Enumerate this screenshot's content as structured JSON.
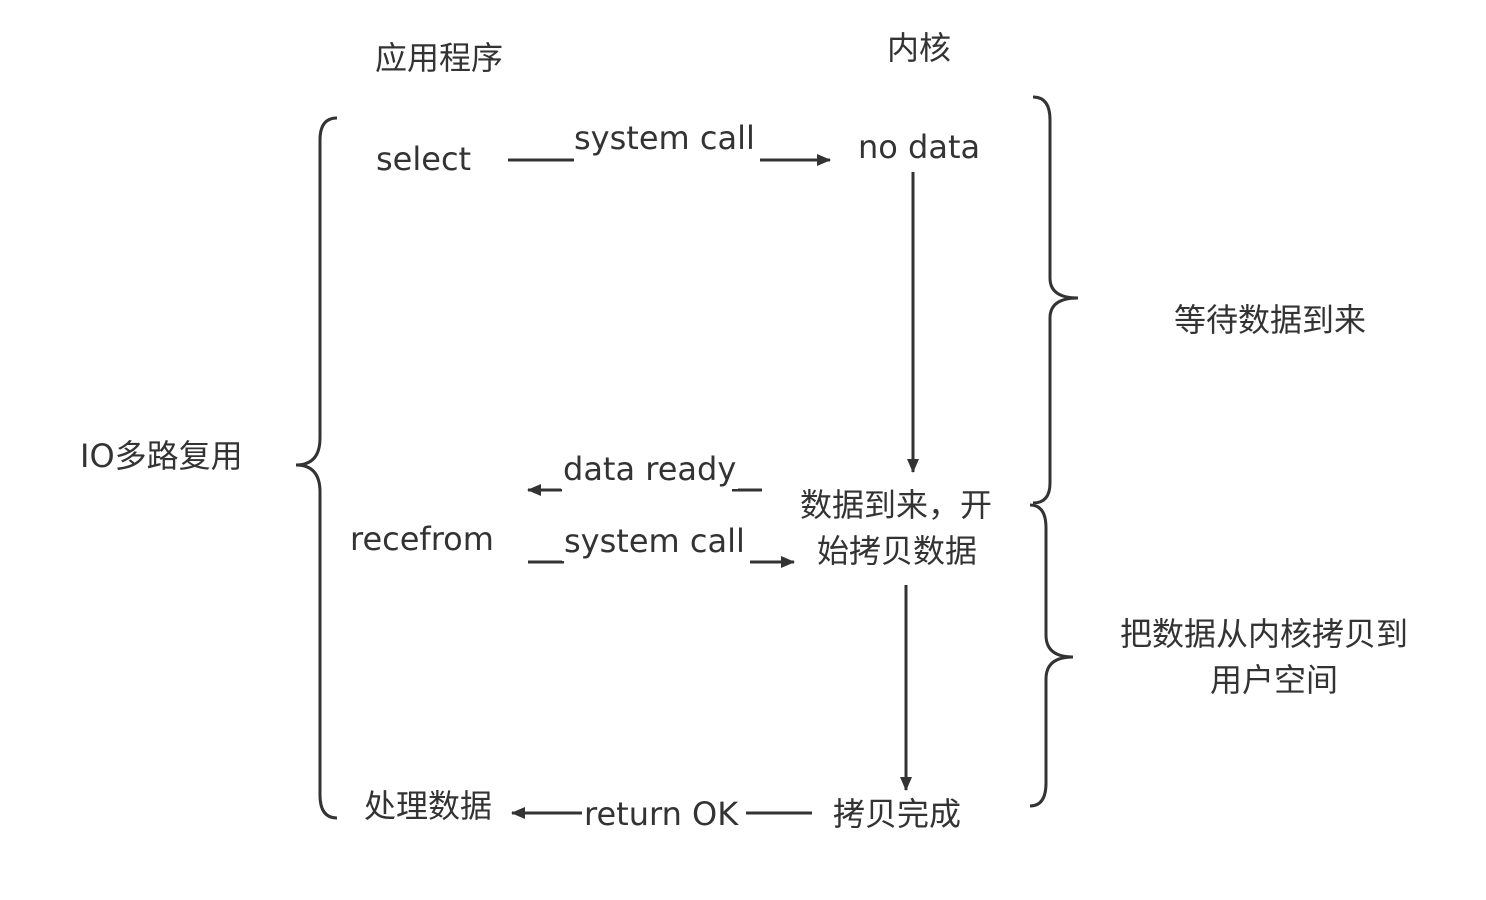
{
  "headers": {
    "app": "应用程序",
    "kernel": "内核"
  },
  "app_steps": {
    "select": "select",
    "recvfrom": "recefrom",
    "process": "处理数据"
  },
  "kernel_steps": {
    "no_data": "no data",
    "data_arrived_line1": "数据到来，开",
    "data_arrived_line2": "始拷贝数据",
    "copy_done": "拷贝完成"
  },
  "messages": {
    "system_call_1": "system call",
    "data_ready": "data ready",
    "system_call_2": "system call",
    "return_ok": "return OK"
  },
  "brackets": {
    "io_multiplexing": "IO多路复用",
    "wait_data": "等待数据到来",
    "copy_line1": "把数据从内核拷贝到",
    "copy_line2": "用户空间"
  },
  "colors": {
    "line": "#333333",
    "text": "#333333"
  }
}
